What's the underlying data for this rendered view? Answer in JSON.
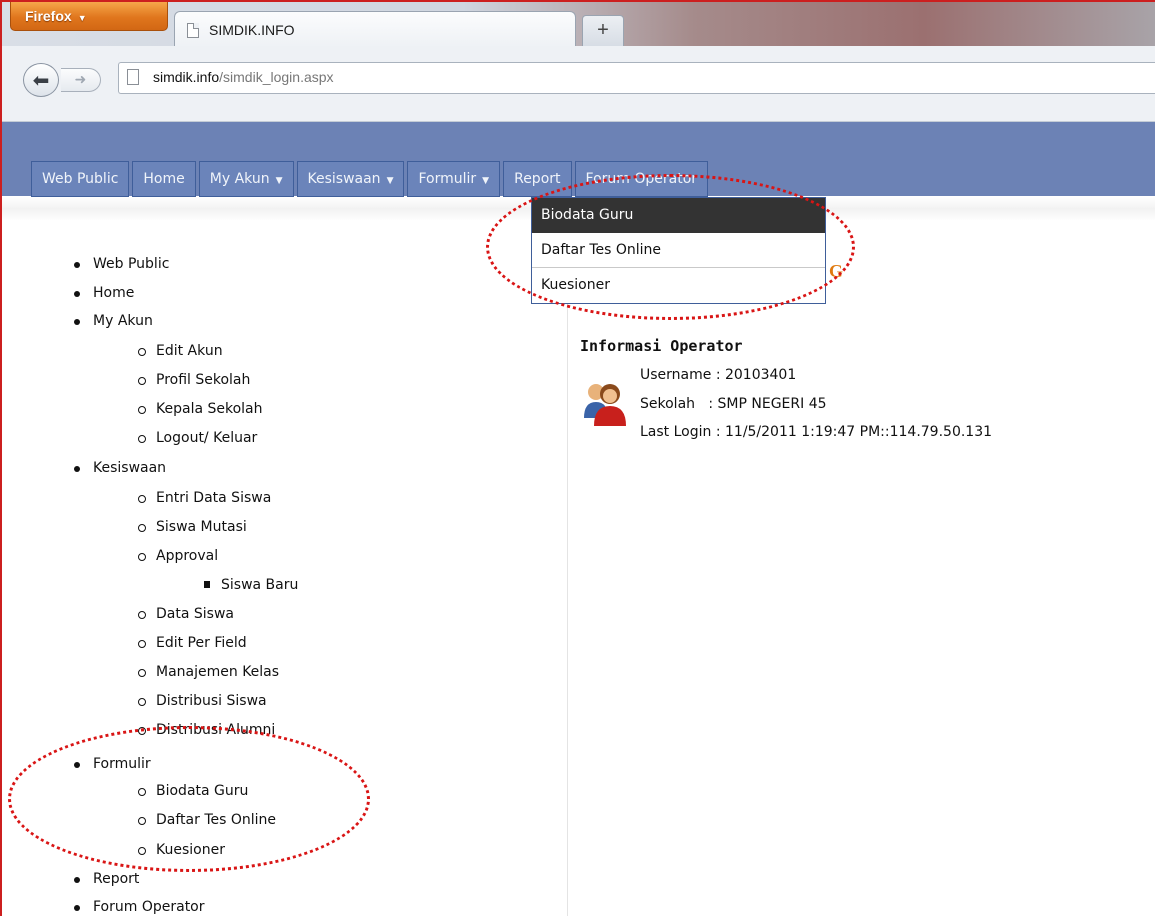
{
  "browser": {
    "app_button": "Firefox",
    "tab_title": "SIMDIK.INFO",
    "new_tab": "+",
    "url_domain": "simdik.info",
    "url_path": "/simdik_login.aspx"
  },
  "menu": {
    "items": [
      {
        "label": "Web Public",
        "dropdown": false
      },
      {
        "label": "Home",
        "dropdown": false
      },
      {
        "label": "My Akun",
        "dropdown": true
      },
      {
        "label": "Kesiswaan",
        "dropdown": true
      },
      {
        "label": "Formulir",
        "dropdown": true
      },
      {
        "label": "Report",
        "dropdown": false
      },
      {
        "label": "Forum Operator",
        "dropdown": false
      }
    ],
    "dropdown_items": [
      "Biodata Guru",
      "Daftar Tes Online",
      "Kuesioner"
    ],
    "highlight_letter": "G"
  },
  "sitemap": {
    "web_public": "Web Public",
    "home": "Home",
    "my_akun": "My Akun",
    "edit_akun": "Edit Akun",
    "profil_sekolah": "Profil Sekolah",
    "kepala_sekolah": "Kepala Sekolah",
    "logout": "Logout/ Keluar",
    "kesiswaan": "Kesiswaan",
    "entri_data_siswa": "Entri Data Siswa",
    "siswa_mutasi": "Siswa Mutasi",
    "approval": "Approval",
    "siswa_baru": "Siswa Baru",
    "data_siswa": "Data Siswa",
    "edit_per_field": "Edit Per Field",
    "manajemen_kelas": "Manajemen Kelas",
    "distribusi_siswa": "Distribusi Siswa",
    "distribusi_alumni": "Distribusi Alumni",
    "formulir": "Formulir",
    "biodata_guru": "Biodata Guru",
    "daftar_tes_online": "Daftar Tes Online",
    "kuesioner": "Kuesioner",
    "report": "Report",
    "forum_operator": "Forum Operator"
  },
  "operator": {
    "title": "Informasi Operator",
    "username": "Username : 20103401",
    "sekolah": "Sekolah   : SMP NEGERI 45",
    "last_login": "Last Login : 11/5/2011 1:19:47 PM::114.79.50.131"
  },
  "colors": {
    "banner": "#6c82b5",
    "annotation": "#d91515",
    "dropdown_active": "#333333"
  }
}
